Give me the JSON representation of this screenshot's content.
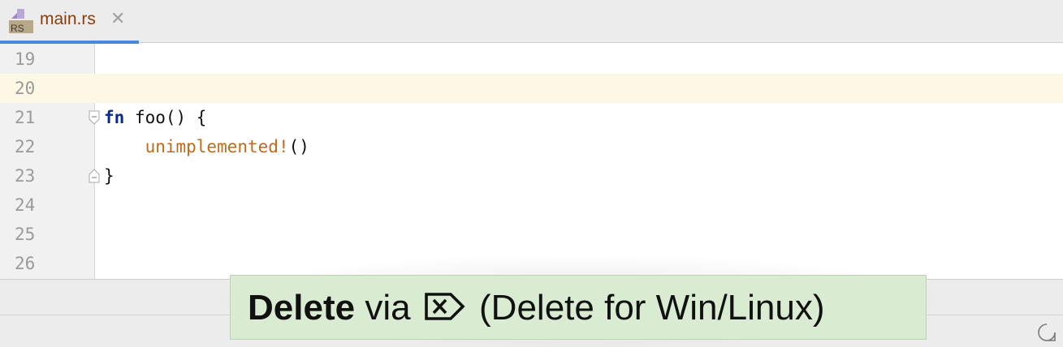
{
  "tab": {
    "icon_label": "RS",
    "title": "main.rs",
    "close_glyph": "✕"
  },
  "editor": {
    "lines": [
      {
        "number": "19",
        "code": ""
      },
      {
        "number": "20",
        "code": ""
      },
      {
        "number": "21",
        "code": "fn foo() {"
      },
      {
        "number": "22",
        "code": "    unimplemented!()"
      },
      {
        "number": "23",
        "code": "}"
      },
      {
        "number": "24",
        "code": ""
      },
      {
        "number": "25",
        "code": ""
      },
      {
        "number": "26",
        "code": ""
      }
    ],
    "current_line": "20",
    "tokens": {
      "fn_keyword": "fn",
      "fn_rest": " foo() {",
      "indent": "    ",
      "macro": "unimplemented!",
      "macro_args": "()",
      "close_brace": "}"
    }
  },
  "tooltip": {
    "action": "Delete",
    "via": "via",
    "key_icon": "delete-key-icon",
    "platform_note": "(Delete for Win/Linux)"
  },
  "colors": {
    "keyword": "#0a2a8c",
    "macro": "#c26a18",
    "tab_title": "#8a3d0a",
    "current_line": "#fdf8e6",
    "tooltip_bg": "#d9ecd2",
    "tab_underline": "#4a88d9"
  }
}
